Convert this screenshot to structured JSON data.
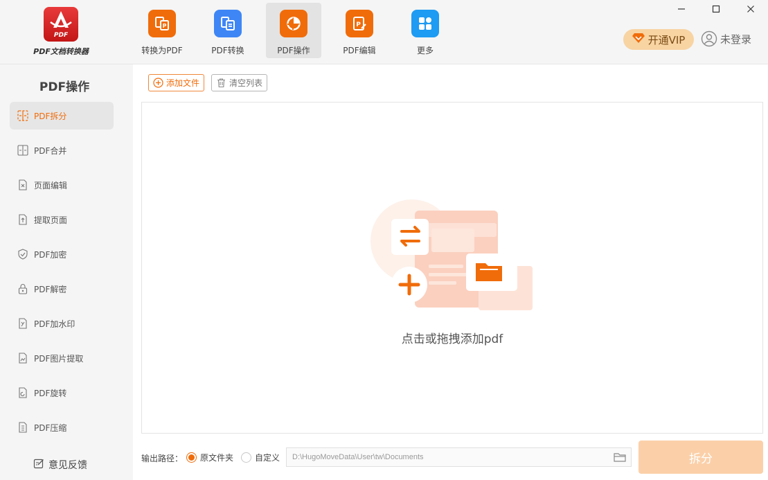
{
  "app": {
    "logo_text": "PDF文档转换器",
    "logo_badge": "PDF"
  },
  "nav": {
    "items": [
      {
        "label": "转换为PDF",
        "icon": "convert-to-pdf-icon",
        "color": "#f06c0a",
        "active": false
      },
      {
        "label": "PDF转换",
        "icon": "pdf-convert-icon",
        "color": "#3e86f5",
        "active": false
      },
      {
        "label": "PDF操作",
        "icon": "pdf-operation-icon",
        "color": "#f06c0a",
        "active": true
      },
      {
        "label": "PDF编辑",
        "icon": "pdf-edit-icon",
        "color": "#f06c0a",
        "active": false
      },
      {
        "label": "更多",
        "icon": "more-apps-icon",
        "color": "#1e9bf2",
        "active": false
      }
    ]
  },
  "window": {
    "minimize": "—",
    "maximize": "☐",
    "close": "✕"
  },
  "header": {
    "vip_label": "开通VIP",
    "login_label": "未登录"
  },
  "sidebar": {
    "title": "PDF操作",
    "items": [
      {
        "label": "PDF拆分",
        "active": true
      },
      {
        "label": "PDF合并",
        "active": false
      },
      {
        "label": "页面编辑",
        "active": false
      },
      {
        "label": "提取页面",
        "active": false
      },
      {
        "label": "PDF加密",
        "active": false
      },
      {
        "label": "PDF解密",
        "active": false
      },
      {
        "label": "PDF加水印",
        "active": false
      },
      {
        "label": "PDF图片提取",
        "active": false
      },
      {
        "label": "PDF旋转",
        "active": false
      },
      {
        "label": "PDF压缩",
        "active": false
      }
    ],
    "feedback_label": "意见反馈"
  },
  "toolbar": {
    "add_file_label": "添加文件",
    "clear_list_label": "清空列表"
  },
  "dropzone": {
    "hint": "点击或拖拽添加pdf"
  },
  "output": {
    "label": "输出路径：",
    "option_original": "原文件夹",
    "option_custom": "自定义",
    "selected": "原文件夹",
    "path": "D:\\HugoMoveData\\User\\tw\\Documents"
  },
  "action": {
    "split_label": "拆分"
  },
  "colors": {
    "accent": "#f06c0a",
    "accent_light": "#fbd0a9",
    "vip_bg": "#f8d4a3",
    "blue": "#3e86f5"
  }
}
